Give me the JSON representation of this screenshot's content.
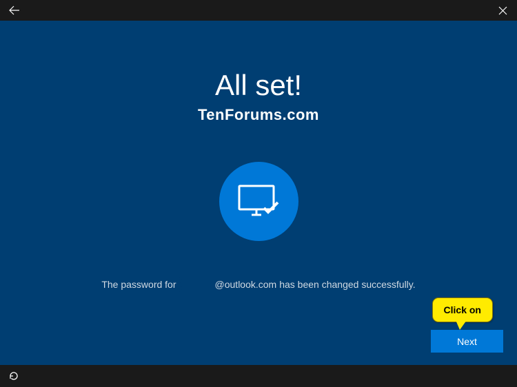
{
  "heading": "All set!",
  "watermark": "TenForums.com",
  "status": {
    "prefix": "The password for",
    "domain": "@outlook.com",
    "suffix": "has been changed successfully."
  },
  "buttons": {
    "next": "Next"
  },
  "tooltip": "Click on"
}
